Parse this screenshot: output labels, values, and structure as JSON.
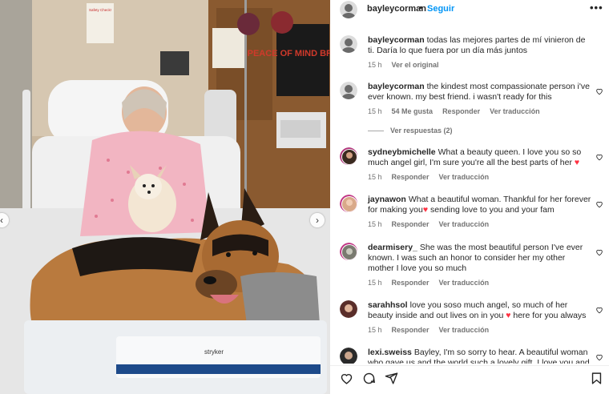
{
  "post": {
    "username": "bayleycorman",
    "separator": "•",
    "follow_label": "Seguir",
    "more_icon": "more-horizontal-icon"
  },
  "comments": [
    {
      "username": "bayleycorman",
      "text": "todas las mejores partes de mí vinieron de ti. Daría lo que fuera por un día más juntos",
      "time": "15 h",
      "likes": "",
      "action": "Ver el original",
      "avatar_color": "#6a6a6a"
    },
    {
      "username": "bayleycorman",
      "text": "the kindest most compassionate person i've ever known. my best friend. i wasn't ready for this",
      "time": "15 h",
      "likes": "54 Me gusta",
      "reply_label": "Responder",
      "action": "Ver traducción",
      "replies_label": "Ver respuestas (2)",
      "avatar_color": "#6a6a6a"
    },
    {
      "username": "sydneybmichelle",
      "text": "What a beauty queen. I love you so so much angel girl, I'm sure you're all the best parts of her",
      "emoji": "♥",
      "time": "15 h",
      "reply_label": "Responder",
      "action": "Ver traducción",
      "avatar_color": "#3a2a20"
    },
    {
      "username": "jaynawon",
      "text": "What a beautiful woman. Thankful for her forever for making you",
      "emoji": "♥",
      "text_after": "sending love to you and your fam",
      "time": "15 h",
      "reply_label": "Responder",
      "action": "Ver traducción",
      "avatar_color": "#d9a98a"
    },
    {
      "username": "dearmisery_",
      "text": "She was the most beautiful person I've ever known. I was such an honor to consider her my other mother I love you so much",
      "time": "15 h",
      "reply_label": "Responder",
      "action": "Ver traducción",
      "avatar_color": "#7a7a70"
    },
    {
      "username": "sarahhsol",
      "text": "love you soso much angel, so much of her beauty inside and out lives on in you",
      "emoji": "♥",
      "text_after": "here for you always",
      "time": "15 h",
      "reply_label": "Responder",
      "action": "Ver traducción",
      "avatar_color": "#5a2e2a"
    },
    {
      "username": "lexi.sweiss",
      "text": "Bayley, I'm so sorry to hear. A beautiful woman who gave us and the world such a lovely gift. I love you and",
      "avatar_color": "#2a2a2a"
    }
  ],
  "photo_text": {
    "sign": "Safety Check!",
    "poster": "PEACE OF MIND BRING IT",
    "bed_brand": "stryker"
  },
  "icons": {
    "like": "heart-icon",
    "comment": "comment-icon",
    "share": "send-icon",
    "save": "bookmark-icon"
  },
  "colors": {
    "follow_blue": "#0095f6",
    "heart_red": "#ff3040",
    "meta_gray": "#737373"
  }
}
